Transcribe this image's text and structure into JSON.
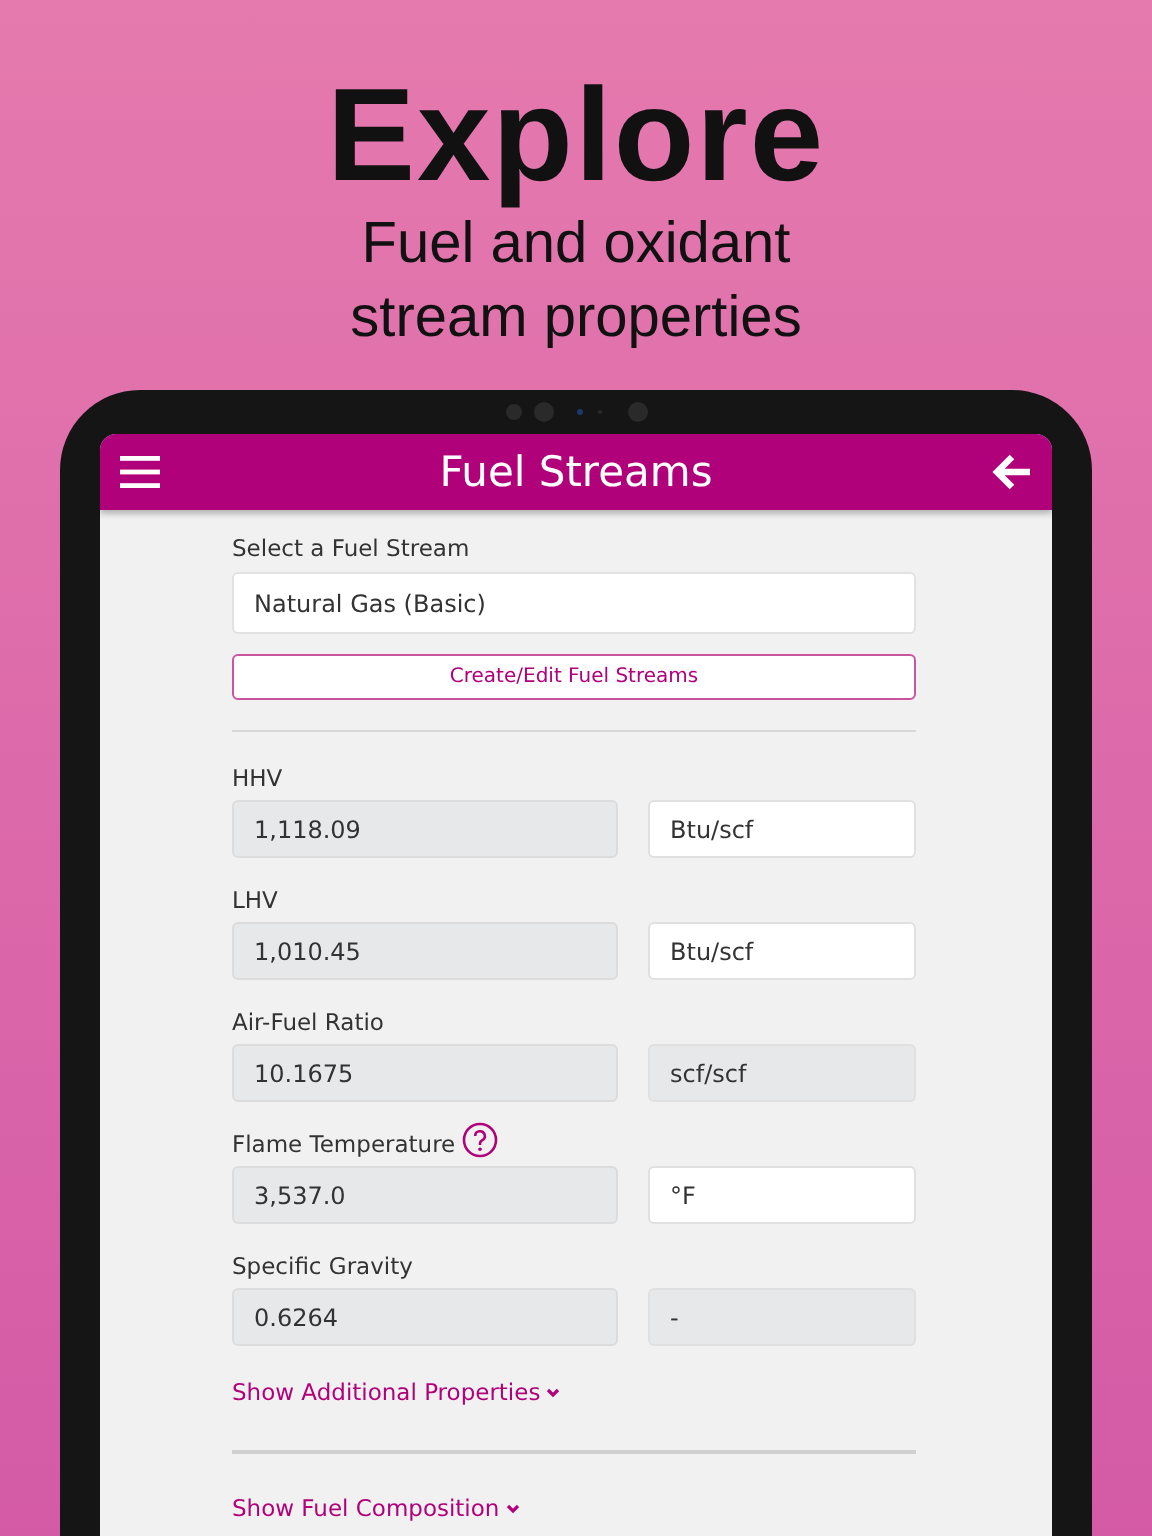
{
  "headline": {
    "title": "Explore",
    "subtitle_lines": [
      "Fuel and oxidant",
      "stream properties"
    ]
  },
  "app_bar": {
    "title": "Fuel Streams"
  },
  "fuel_stream": {
    "label": "Select a Fuel Stream",
    "value": "Natural Gas (Basic)",
    "button": "Create/Edit Fuel Streams"
  },
  "properties": [
    {
      "label": "HHV",
      "help": false,
      "value": "1,118.09",
      "unit": "Btu/scf",
      "unit_disabled": false
    },
    {
      "label": "LHV",
      "help": false,
      "value": "1,010.45",
      "unit": "Btu/scf",
      "unit_disabled": false
    },
    {
      "label": "Air-Fuel Ratio",
      "help": false,
      "value": "10.1675",
      "unit": "scf/scf",
      "unit_disabled": true
    },
    {
      "label": "Flame Temperature",
      "help": true,
      "value": "3,537.0",
      "unit": "°F",
      "unit_disabled": false
    },
    {
      "label": "Specific Gravity",
      "help": false,
      "value": "0.6264",
      "unit": "-",
      "unit_disabled": true
    }
  ],
  "links": [
    {
      "text": "Show Additional Properties",
      "expanded": false
    },
    {
      "text": "Show Fuel Composition",
      "expanded": false
    }
  ]
}
